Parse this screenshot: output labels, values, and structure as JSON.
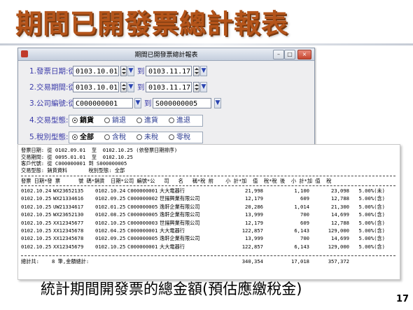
{
  "slide": {
    "title": "期間已開發票總計報表",
    "caption": "統計期間開發票的總金額(預估應繳稅金)",
    "page_number": "17"
  },
  "window": {
    "title": "期間已開發票總計報表",
    "minimize": "–",
    "maximize": "□",
    "close": "×"
  },
  "form": {
    "invoice_date": {
      "label": "1.發票日期:從",
      "from": "0103.10.01",
      "to_label": "到",
      "to": "0103.11.17"
    },
    "trade_period": {
      "label": "2.交易期間:從",
      "from": "0103.10.01",
      "to_label": "到",
      "to": "0103.11.17"
    },
    "company_id": {
      "label": "3.公司編號:從",
      "from": "C000000001",
      "to_label": "到",
      "to": "S000000005"
    },
    "trade_type": {
      "label": "4.交易型態:",
      "options": [
        {
          "label": "銷貨",
          "selected": true
        },
        {
          "label": "銷退",
          "selected": false
        },
        {
          "label": "進貨",
          "selected": false
        },
        {
          "label": "進退",
          "selected": false
        }
      ]
    },
    "tax_type": {
      "label": "5.稅別型態:",
      "options": [
        {
          "label": "全部",
          "selected": true
        },
        {
          "label": "含稅",
          "selected": false
        },
        {
          "label": "未稅",
          "selected": false
        },
        {
          "label": "零稅",
          "selected": false
        }
      ]
    }
  },
  "report": {
    "header_lines": [
      "發票日期: 從 0102.09.01  至  0102.10.25 (依發票日期排序)",
      "交易期間: 從 0095.01.01  至  0102.10.25",
      "客戶代號: 從 C000000001 到 S000000005",
      "交易型態: 銷貨資料       稅別型態: 全部"
    ],
    "columns": [
      "發票",
      "日期",
      "發票",
      "號碼",
      "銷貨",
      "日期",
      "公司",
      "編號",
      "公",
      "司",
      "名",
      "稱",
      "稅前",
      "小計",
      "加值",
      "稅",
      "稅後",
      "小計",
      "加值",
      "稅"
    ],
    "column_header_line": "發票 日期*發 票      號 碼*銷貨  日期*公司 編號*公   司   名   稱*稅 前    小 計*加  值  稅*稅 後  小 計*加 值  稅",
    "rows": [
      {
        "inv_date": "0102.10.24",
        "inv_no": "WX23652135",
        "sale_date": "0102.10.24",
        "company_id": "C000000001",
        "company_name": "大大電器行",
        "pre_tax": "21,998",
        "vat": "1,100",
        "after_tax": "23,098",
        "rate": "5.00%(未)"
      },
      {
        "inv_date": "0102.10.25",
        "inv_no": "WX21334616",
        "sale_date": "0102.09.25",
        "company_id": "C000000002",
        "company_name": "世揚興業有限公司",
        "pre_tax": "12,179",
        "vat": "609",
        "after_tax": "12,788",
        "rate": "5.00%(含)"
      },
      {
        "inv_date": "0102.10.25",
        "inv_no": "UW21334617",
        "sale_date": "0102.01.25",
        "company_id": "C000000005",
        "company_name": "逸軒企業有限公司",
        "pre_tax": "20,286",
        "vat": "1,014",
        "after_tax": "21,300",
        "rate": "5.00%(含)"
      },
      {
        "inv_date": "0102.10.25",
        "inv_no": "WX23652130",
        "sale_date": "0102.08.25",
        "company_id": "C000000005",
        "company_name": "逸軒企業有限公司",
        "pre_tax": "13,999",
        "vat": "700",
        "after_tax": "14,699",
        "rate": "5.00%(含)"
      },
      {
        "inv_date": "0102.10.25",
        "inv_no": "XX12345677",
        "sale_date": "0102.10.25",
        "company_id": "C000000003",
        "company_name": "世揚興業有限公司",
        "pre_tax": "12,179",
        "vat": "609",
        "after_tax": "12,788",
        "rate": "5.00%(含)"
      },
      {
        "inv_date": "0102.10.25",
        "inv_no": "XX12345678",
        "sale_date": "0102.04.25",
        "company_id": "C000000001",
        "company_name": "大大電器行",
        "pre_tax": "122,857",
        "vat": "6,143",
        "after_tax": "129,000",
        "rate": "5.00%(含)"
      },
      {
        "inv_date": "0102.10.25",
        "inv_no": "XX12345678",
        "sale_date": "0102.09.25",
        "company_id": "C000000005",
        "company_name": "逸軒企業有限公司",
        "pre_tax": "13,999",
        "vat": "700",
        "after_tax": "14,699",
        "rate": "5.00%(含)"
      },
      {
        "inv_date": "0102.10.25",
        "inv_no": "XX12345679",
        "sale_date": "0102.10.25",
        "company_id": "C000000001",
        "company_name": "大大電器行",
        "pre_tax": "122,857",
        "vat": "6,143",
        "after_tax": "129,000",
        "rate": "5.00%(含)"
      }
    ],
    "total": {
      "label": "總計共:",
      "count_text": "8 筆,金額總計:",
      "pre_tax": "340,354",
      "vat": "17,018",
      "after_tax": "357,372"
    }
  }
}
